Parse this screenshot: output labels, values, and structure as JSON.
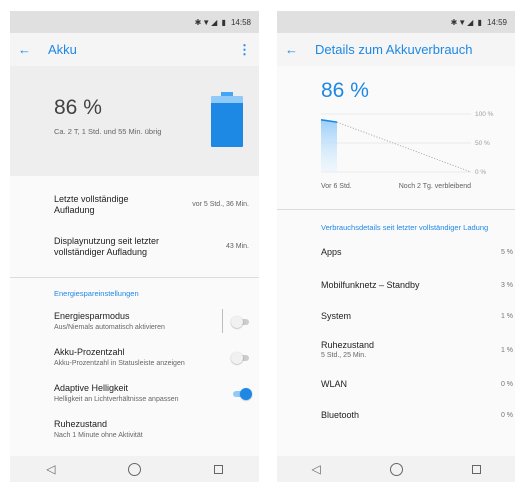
{
  "left": {
    "status": {
      "icons": "✱▼◢ ▮",
      "time": "14:58"
    },
    "appbar": {
      "title": "Akku",
      "more": "⋮"
    },
    "header": {
      "percent": "86 %",
      "remaining": "Ca. 2 T, 1 Std. und 55 Min. übrig",
      "battery_level": 0.86
    },
    "rows": [
      {
        "title": "Letzte vollständige Aufladung",
        "value": "vor 5 Std., 36 Min."
      },
      {
        "title": "Displaynutzung seit letzter vollständiger Aufladung",
        "value": "43 Min."
      }
    ],
    "section": "Energiespareinstellungen",
    "settings": [
      {
        "title": "Energiesparmodus",
        "subtitle": "Aus/Niemals automatisch aktivieren",
        "on": false
      },
      {
        "title": "Akku-Prozentzahl",
        "subtitle": "Akku-Prozentzahl in Statusleiste anzeigen",
        "on": false
      },
      {
        "title": "Adaptive Helligkeit",
        "subtitle": "Helligkeit an Lichtverhältnisse anpassen",
        "on": true
      },
      {
        "title": "Ruhezustand",
        "subtitle": "Nach 1 Minute ohne Aktivität"
      }
    ]
  },
  "right": {
    "status": {
      "icons": "✱▼◢ ▮",
      "time": "14:59"
    },
    "appbar": {
      "title": "Details zum Akkuverbrauch"
    },
    "percent": "86 %",
    "chart_data": {
      "type": "line",
      "y_ticks": [
        "100 %",
        "50 %",
        "0 %"
      ],
      "x_labels": [
        "Vor 6 Std.",
        "Noch 2 Tg. verbleibend"
      ],
      "ylim": [
        0,
        100
      ],
      "history": [
        90,
        86
      ],
      "projection": [
        86,
        0
      ]
    },
    "section": "Verbrauchsdetails seit letzter vollständiger Ladung",
    "items": [
      {
        "name": "Apps",
        "value": "5 %"
      },
      {
        "name": "Mobilfunknetz – Standby",
        "value": "3 %"
      },
      {
        "name": "System",
        "value": "1 %"
      },
      {
        "name": "Ruhezustand",
        "sub": "5 Std., 25 Min.",
        "value": "1 %"
      },
      {
        "name": "WLAN",
        "value": "0 %"
      },
      {
        "name": "Bluetooth",
        "value": "0 %"
      }
    ]
  },
  "nav": {
    "back": "◁"
  },
  "colors": {
    "accent": "#1e88e5",
    "header_bg": "#eeeeee"
  }
}
